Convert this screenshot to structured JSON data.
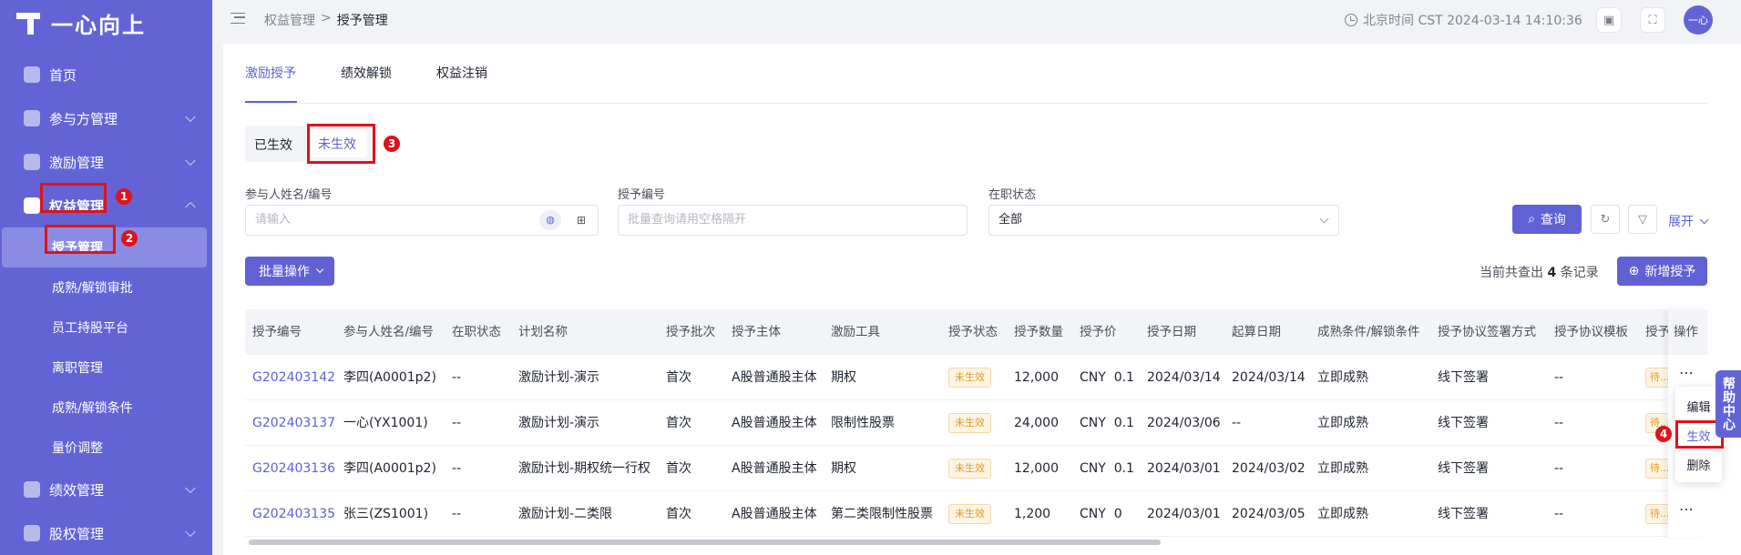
{
  "brand": {
    "name": "一心向上"
  },
  "sidebar": {
    "items": [
      {
        "label": "首页"
      },
      {
        "label": "参与方管理"
      },
      {
        "label": "激励管理"
      },
      {
        "label": "权益管理"
      },
      {
        "label": "绩效管理"
      },
      {
        "label": "股权管理"
      }
    ],
    "sub_items": [
      {
        "label": "授予管理"
      },
      {
        "label": "成熟/解锁审批"
      },
      {
        "label": "员工持股平台"
      },
      {
        "label": "离职管理"
      },
      {
        "label": "成熟/解锁条件"
      },
      {
        "label": "量价调整"
      }
    ]
  },
  "topbar": {
    "crumbs": [
      "权益管理",
      ">",
      "授予管理"
    ],
    "clock": "北京时间 CST 2024-03-14 14:10:36",
    "avatar": "一心"
  },
  "tabs": [
    "激励授予",
    "绩效解锁",
    "权益注销"
  ],
  "segment": [
    "已生效",
    "未生效"
  ],
  "filters": {
    "name_label": "参与人姓名/编号",
    "name_placeholder": "请输入",
    "code_label": "授予编号",
    "code_placeholder": "批量查询请用空格隔开",
    "status_label": "在职状态",
    "status_value": "全部"
  },
  "buttons": {
    "query": "查询",
    "expand": "展开",
    "batch": "批量操作",
    "add": "新增授予"
  },
  "records": {
    "prefix": "当前共查出",
    "count": "4",
    "suffix": "条记录"
  },
  "table": {
    "headers": [
      "授予编号",
      "参与人姓名/编号",
      "在职状态",
      "计划名称",
      "授予批次",
      "授予主体",
      "激励工具",
      "授予状态",
      "授予数量",
      "授予价",
      "授予日期",
      "起算日期",
      "成熟条件/解锁条件",
      "授予协议签署方式",
      "授予协议模板",
      "授予",
      "操作"
    ],
    "rows": [
      [
        "G202403142",
        "李四(A0001p2)",
        "--",
        "激励计划-演示",
        "首次",
        "A股普通股主体",
        "期权",
        "未生效",
        "12,000",
        "CNY  0.1",
        "2024/03/14",
        "2024/03/14",
        "立即成熟",
        "线下签署",
        "--",
        "待..."
      ],
      [
        "G202403137",
        "一心(YX1001)",
        "--",
        "激励计划-演示",
        "首次",
        "A股普通股主体",
        "限制性股票",
        "未生效",
        "24,000",
        "CNY  0.1",
        "2024/03/06",
        "--",
        "立即成熟",
        "线下签署",
        "--",
        "待..."
      ],
      [
        "G202403136",
        "李四(A0001p2)",
        "--",
        "激励计划-期权统一行权",
        "首次",
        "A股普通股主体",
        "期权",
        "未生效",
        "12,000",
        "CNY  0.1",
        "2024/03/01",
        "2024/03/02",
        "立即成熟",
        "线下签署",
        "--",
        "待..."
      ],
      [
        "G202403135",
        "张三(ZS1001)",
        "--",
        "激励计划-二类限",
        "首次",
        "A股普通股主体",
        "第二类限制性股票",
        "未生效",
        "1,200",
        "CNY  0",
        "2024/03/01",
        "2024/03/05",
        "立即成熟",
        "线下签署",
        "--",
        "待..."
      ]
    ]
  },
  "dropdown": [
    "编辑",
    "生效",
    "删除"
  ],
  "help": "帮助中心",
  "annotations": [
    "1",
    "2",
    "3",
    "4"
  ],
  "colors": {
    "sidebar": "#6264d6",
    "primary": "#5f61d4",
    "highlight": "#e0121b",
    "tag": "#e39a22"
  }
}
